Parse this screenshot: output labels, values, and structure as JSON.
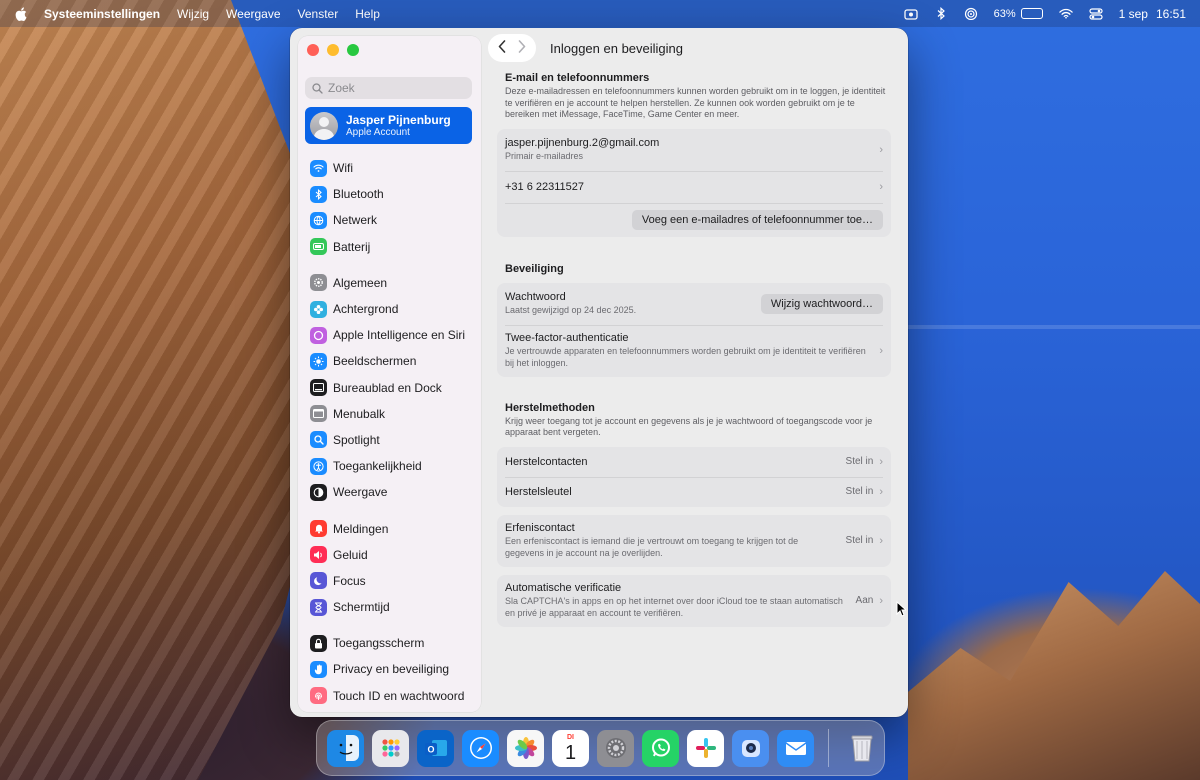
{
  "menubar": {
    "app": "Systeeminstellingen",
    "menus": [
      "Wijzig",
      "Weergave",
      "Venster",
      "Help"
    ],
    "battery_percent": "63%",
    "battery_level": 0.63,
    "date": "1 sep",
    "time": "16:51",
    "icons": [
      "apple-icon",
      "screen-record-icon",
      "bluetooth-icon",
      "airdrop-icon",
      "wifi-icon",
      "control-center-icon"
    ]
  },
  "sidebar": {
    "search_placeholder": "Zoek",
    "account": {
      "name": "Jasper Pijnenburg",
      "subtitle": "Apple Account"
    },
    "groups": [
      [
        {
          "label": "Wifi",
          "icon": "wifi-icon",
          "color": "#1a8cff"
        },
        {
          "label": "Bluetooth",
          "icon": "bluetooth-icon",
          "color": "#1a8cff"
        },
        {
          "label": "Netwerk",
          "icon": "globe-icon",
          "color": "#1a8cff"
        },
        {
          "label": "Batterij",
          "icon": "battery-icon",
          "color": "#34c759"
        }
      ],
      [
        {
          "label": "Algemeen",
          "icon": "gear-icon",
          "color": "#8e8e93"
        },
        {
          "label": "Achtergrond",
          "icon": "flower-icon",
          "color": "#30b0e0"
        },
        {
          "label": "Apple Intelligence en Siri",
          "icon": "siri-icon",
          "color": "#c060e0"
        },
        {
          "label": "Beeldschermen",
          "icon": "sun-icon",
          "color": "#1a8cff"
        },
        {
          "label": "Bureaublad en Dock",
          "icon": "dock-icon",
          "color": "#1d1d1f"
        },
        {
          "label": "Menubalk",
          "icon": "menubar-icon",
          "color": "#8e8e93"
        },
        {
          "label": "Spotlight",
          "icon": "magnifier-icon",
          "color": "#1a8cff"
        },
        {
          "label": "Toegankelijkheid",
          "icon": "accessibility-icon",
          "color": "#1a8cff"
        },
        {
          "label": "Weergave",
          "icon": "appearance-icon",
          "color": "#1d1d1f"
        }
      ],
      [
        {
          "label": "Meldingen",
          "icon": "bell-icon",
          "color": "#ff3b30"
        },
        {
          "label": "Geluid",
          "icon": "speaker-icon",
          "color": "#ff2d55"
        },
        {
          "label": "Focus",
          "icon": "moon-icon",
          "color": "#5856d6"
        },
        {
          "label": "Schermtijd",
          "icon": "hourglass-icon",
          "color": "#5856d6"
        }
      ],
      [
        {
          "label": "Toegangsscherm",
          "icon": "lock-icon",
          "color": "#1d1d1f"
        },
        {
          "label": "Privacy en beveiliging",
          "icon": "hand-icon",
          "color": "#1a8cff"
        },
        {
          "label": "Touch ID en wachtwoord",
          "icon": "fingerprint-icon",
          "color": "#ff6b81"
        }
      ]
    ]
  },
  "header": {
    "title": "Inloggen en beveiliging"
  },
  "email_section": {
    "title": "E-mail en telefoonnummers",
    "description": "Deze e-mailadressen en telefoonnummers kunnen worden gebruikt om in te loggen, je identiteit te verifiëren en je account te helpen herstellen. Ze kunnen ook worden gebruikt om je te bereiken met iMessage, FaceTime, Game Center en meer.",
    "email": "jasper.pijnenburg.2@gmail.com",
    "email_sub": "Primair e-mailadres",
    "phone": "+31 6 22311527",
    "add_button": "Voeg een e-mailadres of telefoonnummer toe…"
  },
  "security_section": {
    "title": "Beveiliging",
    "password_title": "Wachtwoord",
    "password_sub": "Laatst gewijzigd op 24 dec 2025.",
    "change_password_button": "Wijzig wachtwoord…",
    "twofa_title": "Twee-factor-authenticatie",
    "twofa_sub": "Je vertrouwde apparaten en telefoonnummers worden gebruikt om je identiteit te verifiëren bij het inloggen."
  },
  "recovery_section": {
    "title": "Herstelmethoden",
    "description": "Krijg weer toegang tot je account en gegevens als je je wachtwoord of toegangscode voor je apparaat bent vergeten.",
    "contacts_title": "Herstelcontacten",
    "contacts_value": "Stel in",
    "key_title": "Herstelsleutel",
    "key_value": "Stel in"
  },
  "legacy": {
    "title": "Erfeniscontact",
    "sub": "Een erfeniscontact is iemand die je vertrouwt om toegang te krijgen tot de gegevens in je account na je overlijden.",
    "value": "Stel in"
  },
  "auto_verify": {
    "title": "Automatische verificatie",
    "sub": "Sla CAPTCHA's in apps en op het internet over door iCloud toe te staan automatisch en privé je apparaat en account te verifiëren.",
    "value": "Aan"
  },
  "calendar_icon": {
    "weekday": "DI",
    "day": "1"
  },
  "dock": [
    {
      "name": "finder",
      "color": "#1e88e5"
    },
    {
      "name": "launchpad",
      "color": "#e8e8ec"
    },
    {
      "name": "outlook",
      "color": "#0a64c8"
    },
    {
      "name": "safari",
      "color": "#1a8cff"
    },
    {
      "name": "photos",
      "color": "#f7f7f7"
    },
    {
      "name": "calendar",
      "color": "#ffffff"
    },
    {
      "name": "system-settings",
      "color": "#8e8e93"
    },
    {
      "name": "whatsapp",
      "color": "#25d366"
    },
    {
      "name": "slack",
      "color": "#ffffff"
    },
    {
      "name": "camera-app",
      "color": "#4a8ff0"
    },
    {
      "name": "mail",
      "color": "#2f8cf5"
    },
    {
      "name": "trash",
      "color": "#c9c9cf"
    }
  ]
}
